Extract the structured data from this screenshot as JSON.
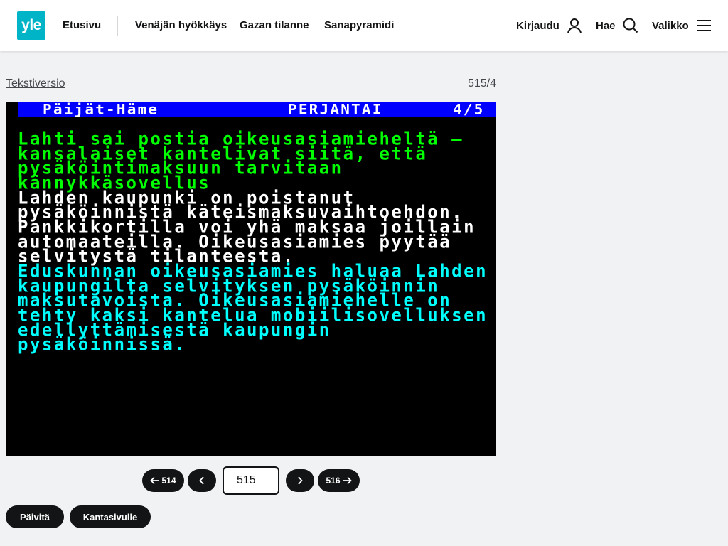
{
  "header": {
    "logo_text": "yle",
    "nav": [
      "Etusivu",
      "Venäjän hyökkäys",
      "Gazan tilanne",
      "Sanapyramidi"
    ],
    "login_label": "Kirjaudu",
    "search_label": "Hae",
    "menu_label": "Valikko",
    "brand_color": "#00b4c8"
  },
  "teletext": {
    "text_version_link": "Tekstiversio",
    "page_id": "515/4",
    "header_region": "Päijät-Häme",
    "header_day": "PERJANTAI",
    "header_page": "4/5",
    "lines": [
      "Lahti sai postia oikeusasiamieheltä –",
      "kansalaiset kantelivat siitä, että",
      "pysäköintimaksuun tarvitaan",
      "kännykkäsovellus",
      "Lahden kaupunki on poistanut",
      "pysäköinnistä käteismaksuvaihtoehdon.",
      "Pankkikortilla voi yhä maksaa joillain",
      "automaateilla. Oikeusasiamies pyytää",
      "selvitystä tilanteesta.",
      "Eduskunnan oikeusasiamies haluaa Lahden",
      "kaupungilta selvityksen pysäköinnin",
      "maksutavoista. Oikeusasiamiehelle on",
      "tehty kaksi kantelua mobiilisovelluksen",
      "edellyttämisestä kaupungin",
      "pysäköinnissä."
    ],
    "line_colors": {
      "headline": "#00ff00",
      "lead": "#ffffff",
      "body": "#00ffff",
      "header_bg": "#0000ff"
    }
  },
  "pager": {
    "prev_page_label": "514",
    "next_page_label": "516",
    "page_input_value": "515"
  },
  "actions": {
    "refresh_label": "Päivitä",
    "home_label": "Kantasivulle"
  }
}
